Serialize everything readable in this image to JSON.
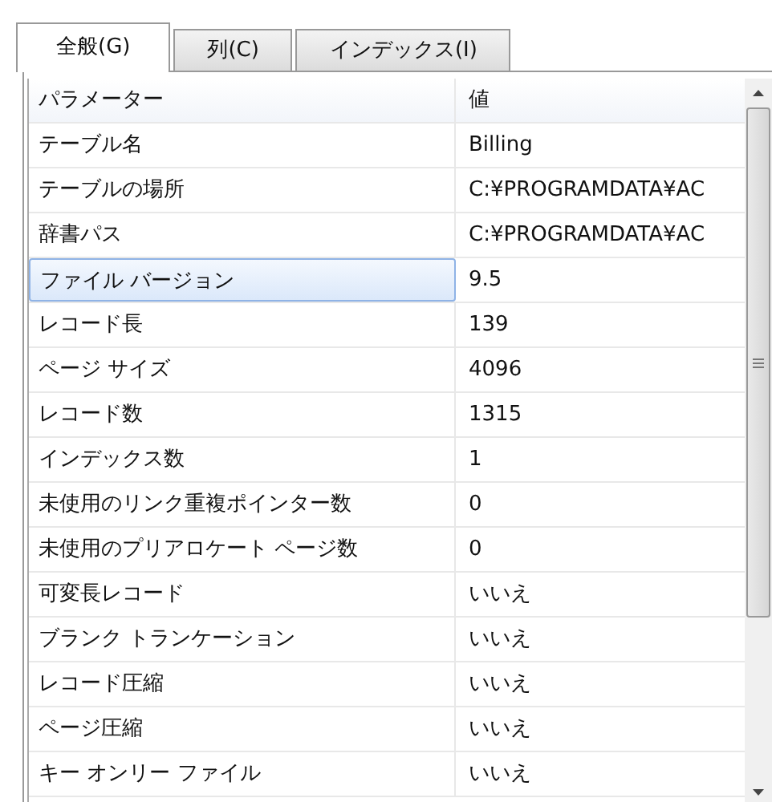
{
  "tabs": [
    {
      "label": "全般(G)",
      "selected": true
    },
    {
      "label": "列(C)",
      "selected": false
    },
    {
      "label": "インデックス(I)",
      "selected": false
    }
  ],
  "table": {
    "columns": [
      "パラメーター",
      "値"
    ],
    "rows": [
      {
        "name": "テーブル名",
        "value": "Billing",
        "selected": false
      },
      {
        "name": "テーブルの場所",
        "value": "C:¥PROGRAMDATA¥AC",
        "selected": false
      },
      {
        "name": "辞書パス",
        "value": "C:¥PROGRAMDATA¥AC",
        "selected": false
      },
      {
        "name": "ファイル バージョン",
        "value": "9.5",
        "selected": true
      },
      {
        "name": "レコード長",
        "value": "139",
        "selected": false
      },
      {
        "name": "ページ サイズ",
        "value": "4096",
        "selected": false
      },
      {
        "name": "レコード数",
        "value": "1315",
        "selected": false
      },
      {
        "name": "インデックス数",
        "value": "1",
        "selected": false
      },
      {
        "name": "未使用のリンク重複ポインター数",
        "value": "0",
        "selected": false
      },
      {
        "name": "未使用のプリアロケート ページ数",
        "value": "0",
        "selected": false
      },
      {
        "name": "可変長レコード",
        "value": "いいえ",
        "selected": false
      },
      {
        "name": "ブランク トランケーション",
        "value": "いいえ",
        "selected": false
      },
      {
        "name": "レコード圧縮",
        "value": "いいえ",
        "selected": false
      },
      {
        "name": "ページ圧縮",
        "value": "いいえ",
        "selected": false
      },
      {
        "name": "キー オンリー ファイル",
        "value": "いいえ",
        "selected": false
      }
    ]
  }
}
